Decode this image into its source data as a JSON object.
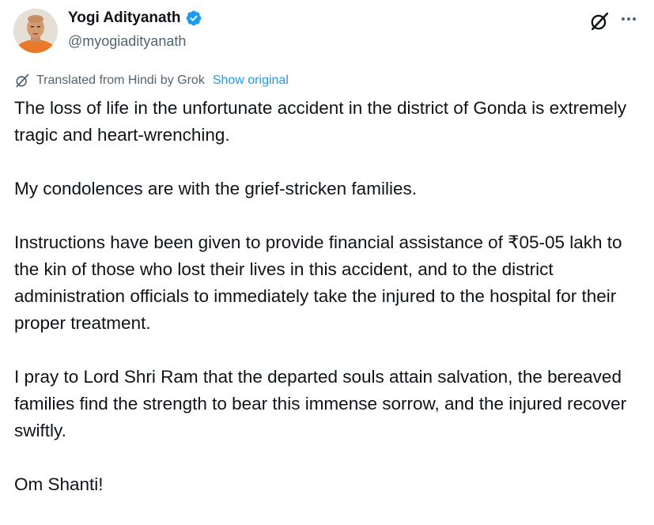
{
  "author": {
    "display_name": "Yogi Adityanath",
    "handle": "@myogiadityanath",
    "verified": true,
    "verified_color": "#1d9bf0"
  },
  "icons": {
    "grok": "grok-icon",
    "more": "more-icon",
    "verified": "verified-badge-icon"
  },
  "translation": {
    "notice": "Translated from Hindi by Grok",
    "show_original": "Show original"
  },
  "tweet": {
    "paragraphs": [
      "The loss of life in the unfortunate accident in the district of Gonda is extremely tragic and heart-wrenching.",
      "My condolences are with the grief-stricken families.",
      "Instructions have been given to provide financial assistance of ₹05-05 lakh to the kin of those who lost their lives in this accident, and to the district administration officials to immediately take the injured to the hospital for their proper treatment.",
      "I pray to Lord Shri Ram that the departed souls attain salvation, the bereaved families find the strength to bear this immense sorrow, and the injured recover swiftly.",
      "Om Shanti!"
    ]
  }
}
